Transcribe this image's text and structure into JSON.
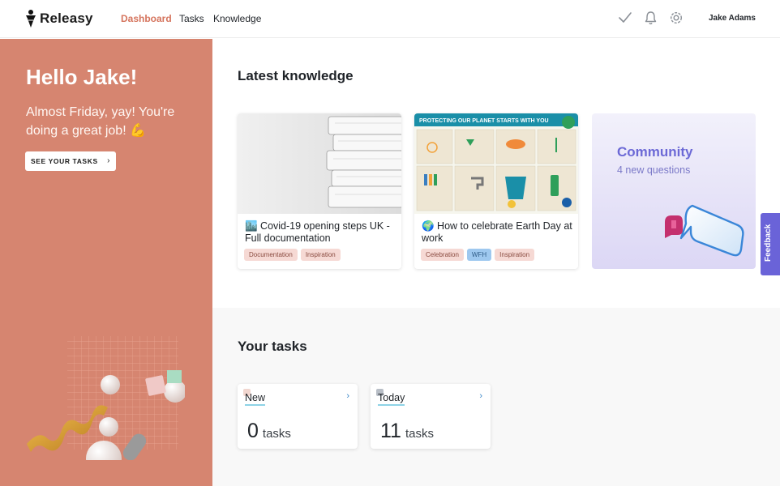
{
  "app": {
    "name": "Releasy"
  },
  "nav": {
    "dashboard": "Dashboard",
    "tasks": "Tasks",
    "knowledge": "Knowledge"
  },
  "user": {
    "name": "Jake Adams"
  },
  "hero": {
    "greeting": "Hello Jake!",
    "message": "Almost Friday, yay! You're doing a great job! 💪",
    "button_label": "SEE YOUR TASKS"
  },
  "knowledge": {
    "title": "Latest knowledge",
    "cards": [
      {
        "title": "🏙️ Covid-19 opening steps UK - Full documentation",
        "tags": [
          "Documentation",
          "Inspiration"
        ]
      },
      {
        "title": "🌍 How to celebrate Earth Day at work",
        "tags": [
          "Celebration",
          "WFH",
          "Inspiration"
        ],
        "poster_heading": "PROTECTING OUR PLANET STARTS WITH YOU"
      }
    ],
    "community": {
      "title": "Community",
      "subtitle": "4 new questions"
    }
  },
  "tasks": {
    "title": "Your tasks",
    "cards": [
      {
        "label": "New",
        "count": "0",
        "unit": "tasks"
      },
      {
        "label": "Today",
        "count": "11",
        "unit": "tasks"
      }
    ]
  },
  "feedback": {
    "label": "Feedback"
  },
  "colors": {
    "accent": "#d5745d",
    "hero_bg": "#d68570",
    "community": "#6c69d6",
    "feedback": "#6a63d8"
  },
  "icons": [
    "logo-icon",
    "check-icon",
    "bell-icon",
    "gear-icon",
    "chevron-right-icon"
  ]
}
